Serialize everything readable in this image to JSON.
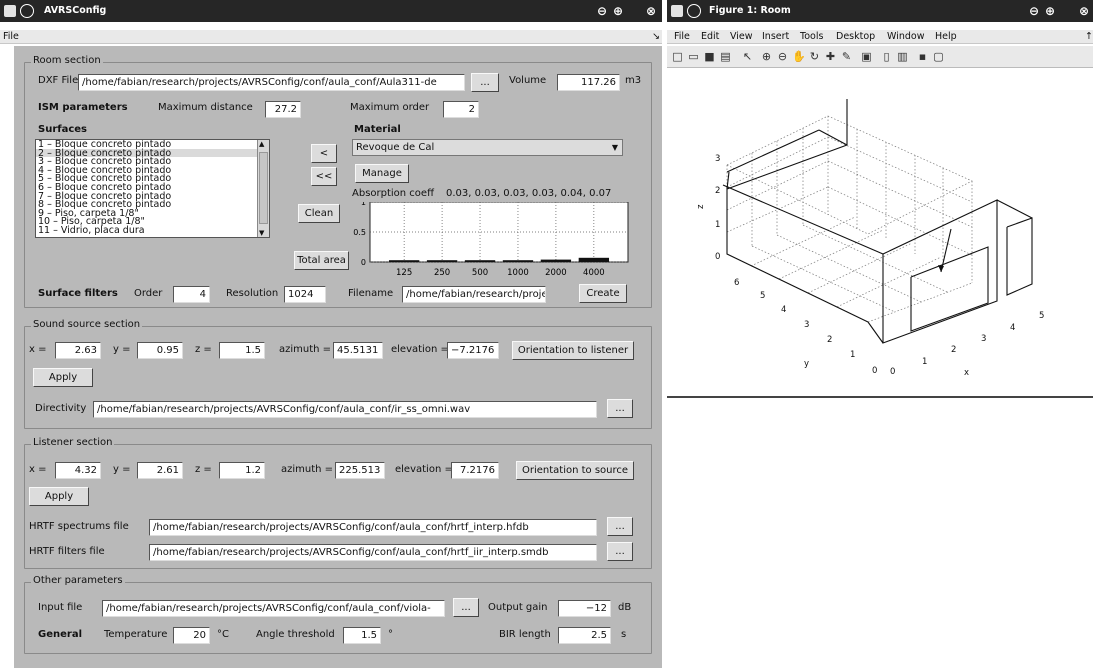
{
  "left_window": {
    "title": "AVRSConfig",
    "menu": {
      "file": "File"
    },
    "room": {
      "legend": "Room section",
      "dxf_label": "DXF File",
      "dxf_value": "/home/fabian/research/projects/AVRSConfig/conf/aula_conf/Aula311-de",
      "browse": "...",
      "volume_label": "Volume",
      "volume_value": "117.26",
      "volume_unit": "m3",
      "ism_label": "ISM parameters",
      "max_dist_label": "Maximum distance",
      "max_dist_value": "27.2",
      "max_order_label": "Maximum order",
      "max_order_value": "2",
      "surfaces_label": "Surfaces",
      "surfaces": [
        "1 – Bloque concreto pintado",
        "2 – Bloque concreto pintado",
        "3 – Bloque concreto pintado",
        "4 – Bloque concreto pintado",
        "5 – Bloque concreto pintado",
        "6 – Bloque concreto pintado",
        "7 – Bloque concreto pintado",
        "8 – Bloque concreto pintado",
        "9 – Piso, carpeta 1/8\"",
        "10 – Piso, carpeta 1/8\"",
        "11 – Vidrio, placa dura"
      ],
      "btn_left": "<",
      "btn_left2": "<<",
      "btn_clean": "Clean",
      "btn_total": "Total area",
      "material_label": "Material",
      "material_value": "Revoque de Cal",
      "btn_manage": "Manage",
      "abs_label": "Absorption coeff",
      "abs_values": "0.03, 0.03, 0.03, 0.03, 0.04, 0.07",
      "filters_label": "Surface filters",
      "order_label": "Order",
      "order_value": "4",
      "resolution_label": "Resolution",
      "resolution_value": "1024",
      "filename_label": "Filename",
      "filename_value": "/home/fabian/research/projects/A",
      "btn_create": "Create"
    },
    "source": {
      "legend": "Sound source section",
      "x_label": "x =",
      "x_value": "2.63",
      "y_label": "y =",
      "y_value": "0.95",
      "z_label": "z =",
      "z_value": "1.5",
      "az_label": "azimuth =",
      "az_value": "45.5131",
      "el_label": "elevation =",
      "el_value": "−7.2176",
      "btn_orient": "Orientation to listener",
      "btn_apply": "Apply",
      "dir_label": "Directivity",
      "dir_value": "/home/fabian/research/projects/AVRSConfig/conf/aula_conf/ir_ss_omni.wav",
      "browse": "..."
    },
    "listener": {
      "legend": "Listener section",
      "x_label": "x =",
      "x_value": "4.32",
      "y_label": "y =",
      "y_value": "2.61",
      "z_label": "z =",
      "z_value": "1.2",
      "az_label": "azimuth =",
      "az_value": "225.513",
      "el_label": "elevation =",
      "el_value": "7.2176",
      "btn_orient": "Orientation to source",
      "btn_apply": "Apply",
      "hrtf_spec_label": "HRTF spectrums file",
      "hrtf_spec_value": "/home/fabian/research/projects/AVRSConfig/conf/aula_conf/hrtf_interp.hfdb",
      "hrtf_filt_label": "HRTF filters file",
      "hrtf_filt_value": "/home/fabian/research/projects/AVRSConfig/conf/aula_conf/hrtf_iir_interp.smdb",
      "browse": "..."
    },
    "other": {
      "legend": "Other parameters",
      "input_label": "Input file",
      "input_value": "/home/fabian/research/projects/AVRSConfig/conf/aula_conf/viola-",
      "browse": "...",
      "gain_label": "Output gain",
      "gain_value": "−12",
      "gain_unit": "dB",
      "general_label": "General",
      "temp_label": "Temperature",
      "temp_value": "20",
      "temp_unit": "°C",
      "angle_label": "Angle threshold",
      "angle_value": "1.5",
      "angle_unit": "°",
      "bir_label": "BIR length",
      "bir_value": "2.5",
      "bir_unit": "s"
    }
  },
  "right_window": {
    "title": "Figure 1: Room",
    "menu": [
      "File",
      "Edit",
      "View",
      "Insert",
      "Tools",
      "Desktop",
      "Window",
      "Help"
    ]
  },
  "chart_data": [
    {
      "type": "bar",
      "categories": [
        "125",
        "250",
        "500",
        "1000",
        "2000",
        "4000"
      ],
      "values": [
        0.03,
        0.03,
        0.03,
        0.03,
        0.04,
        0.07
      ],
      "yticks": [
        "0",
        "0.5",
        "1"
      ],
      "ylim": [
        0,
        1
      ]
    }
  ],
  "plot3d": {
    "xlabel": "x",
    "ylabel": "y",
    "zlabel": "z",
    "xticks": [
      "0",
      "1",
      "2",
      "3",
      "4",
      "5"
    ],
    "yticks": [
      "0",
      "1",
      "2",
      "3",
      "4",
      "5",
      "6"
    ],
    "zticks": [
      "0",
      "1",
      "2",
      "3"
    ]
  },
  "colors": {
    "titlebar": "#262626",
    "panel": "#b9b9b9",
    "figure_bg": "#ffffff"
  }
}
